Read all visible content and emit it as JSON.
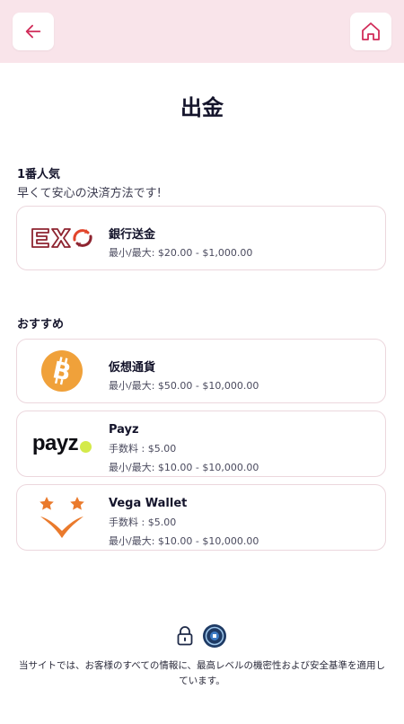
{
  "header": {
    "back_icon": "arrow-left-icon",
    "home_icon": "home-icon",
    "accent_color": "#d12d5a",
    "bar_color": "#f9e4ea"
  },
  "page": {
    "title": "出金"
  },
  "sections": {
    "popular": {
      "title": "1番人気",
      "subtitle": "早くて安心の決済方法です!"
    },
    "recommended": {
      "title": "おすすめ"
    }
  },
  "methods": [
    {
      "name": "銀行送金",
      "logo": "EX",
      "limits": "最小/最大: $20.00 - $1,000.00"
    },
    {
      "name": "仮想通貨",
      "logo": "bitcoin-icon",
      "limits": "最小/最大: $50.00 - $10,000.00"
    },
    {
      "name": "Payz",
      "logo": "payz",
      "fee": "手数料 : $5.00",
      "limits": "最小/最大: $10.00 - $10,000.00"
    },
    {
      "name": "Vega Wallet",
      "logo": "vega-icon",
      "fee": "手数料 : $5.00",
      "limits": "最小/最大: $10.00 - $10,000.00"
    }
  ],
  "footer": {
    "text": "当サイトでは、お客様のすべての情報に、最高レベルの機密性および安全基準を適用しています。",
    "icons": [
      "lock-icon",
      "security-badge-icon"
    ]
  }
}
